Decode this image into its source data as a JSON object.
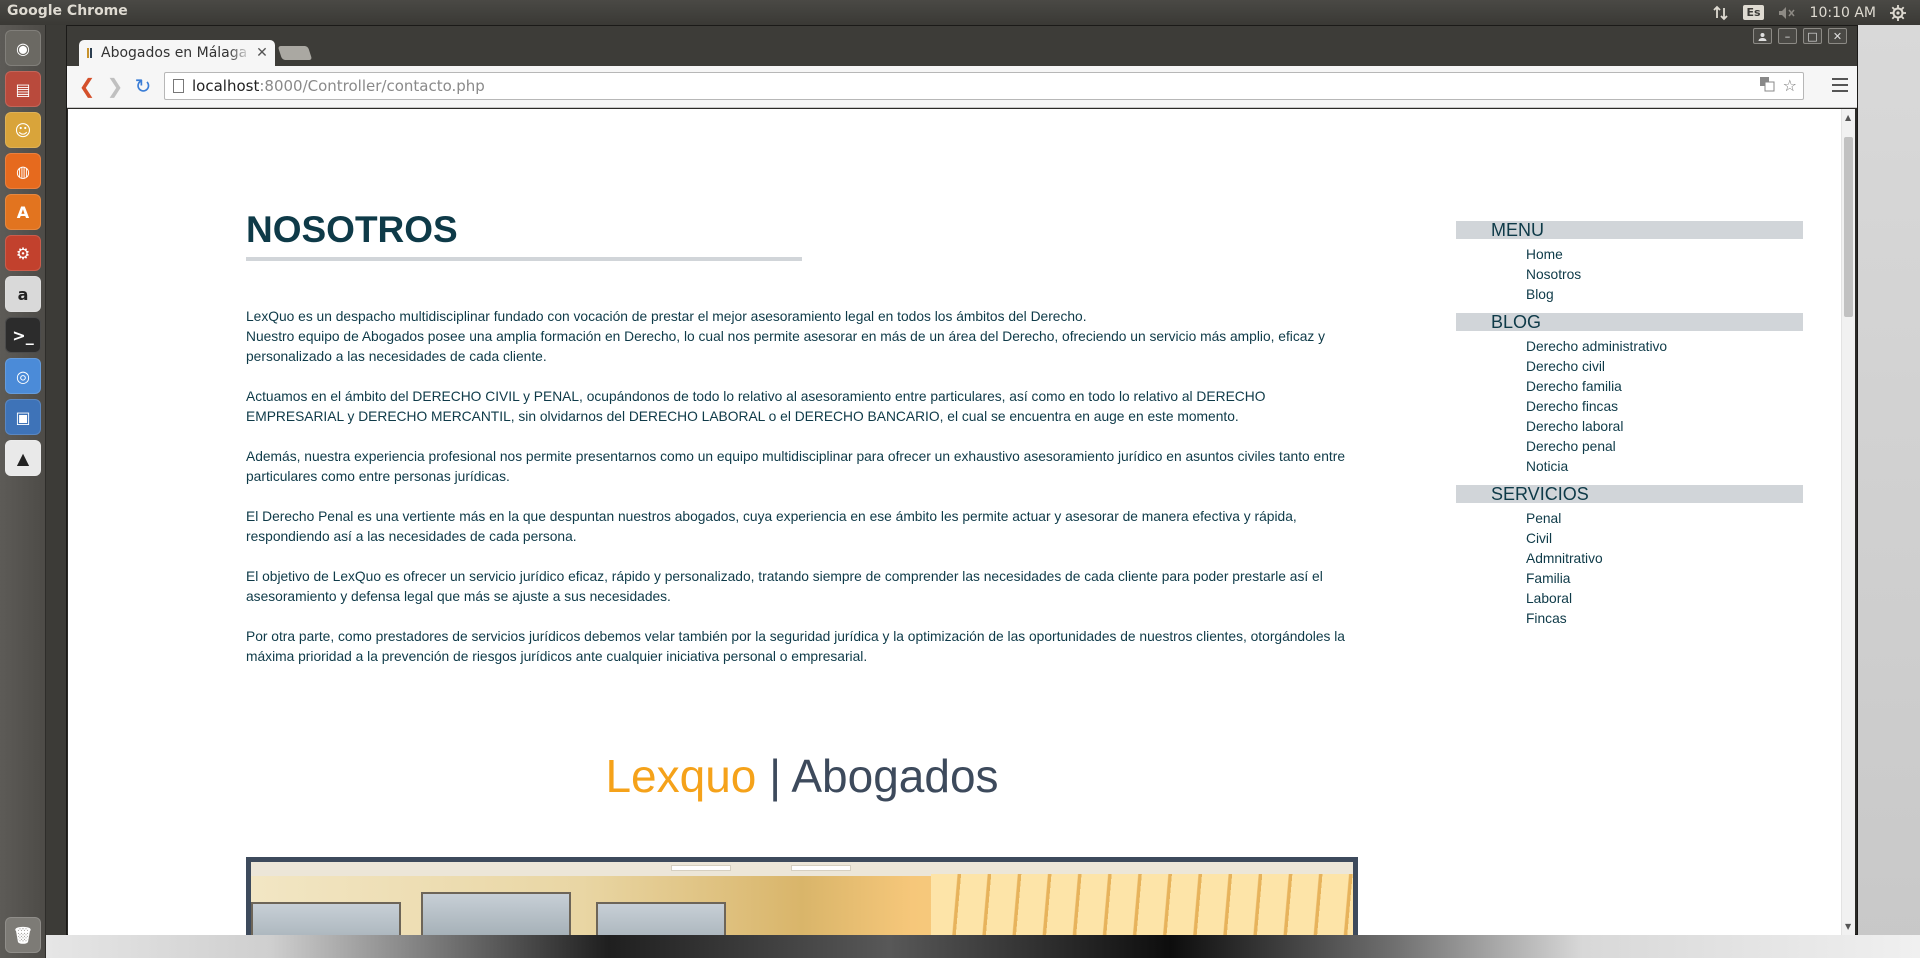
{
  "os": {
    "panel_app_name": "Google Chrome",
    "keyboard_layout": "Es",
    "clock": "10:10 AM"
  },
  "launcher": {
    "items": [
      {
        "name": "dash-home",
        "icon": "ubuntu-logo-icon",
        "color": "#6b6963"
      },
      {
        "name": "files",
        "icon": "file-cabinet-icon",
        "color": "#b94a3c"
      },
      {
        "name": "app-2",
        "icon": "face-icon",
        "color": "#d9a43a"
      },
      {
        "name": "firefox",
        "icon": "firefox-icon",
        "color": "#e66a1e"
      },
      {
        "name": "software-center",
        "icon": "shopping-bag-icon",
        "color": "#e2741f"
      },
      {
        "name": "system-settings",
        "icon": "gears-icon",
        "color": "#c2412d"
      },
      {
        "name": "amazon",
        "icon": "amazon-icon",
        "color": "#d9d9d9"
      },
      {
        "name": "terminal",
        "icon": "terminal-icon",
        "color": "#2c2c2c"
      },
      {
        "name": "chrome",
        "icon": "chrome-icon",
        "color": "#4b8bd8"
      },
      {
        "name": "virtualbox",
        "icon": "box-icon",
        "color": "#3e73b8"
      },
      {
        "name": "pma",
        "icon": "pma-icon",
        "color": "#e9e9e9"
      },
      {
        "name": "trash",
        "icon": "trash-icon",
        "color": "#7d7b76"
      }
    ]
  },
  "browser": {
    "tab_title": "Abogados en Málaga",
    "url_host": "localhost",
    "url_path": ":8000/Controller/contacto.php"
  },
  "page": {
    "title": "NOSOTROS",
    "paragraphs": [
      "LexQuo es un despacho multidisciplinar fundado con vocación de prestar el mejor asesoramiento legal en todos los ámbitos del Derecho.",
      "Nuestro equipo de Abogados posee una amplia formación en Derecho, lo cual nos permite asesorar en más de un área del Derecho, ofreciendo un servicio más amplio, eficaz y personalizado a las necesidades de cada cliente.",
      "Actuamos en el ámbito del DERECHO CIVIL y PENAL, ocupándonos de todo lo relativo al asesoramiento entre particulares, así como en todo lo relativo al DERECHO EMPRESARIAL y DERECHO MERCANTIL, sin olvidarnos del DERECHO LABORAL o el DERECHO BANCARIO, el cual se encuentra en auge en este momento.",
      "Además, nuestra experiencia profesional nos permite presentarnos como un equipo multidisciplinar para ofrecer un exhaustivo asesoramiento jurídico en asuntos civiles tanto entre particulares como entre personas jurídicas.",
      "El Derecho Penal es una vertiente más en la que despuntan nuestros abogados, cuya experiencia en ese ámbito les permite actuar y asesorar de manera efectiva y rápida, respondiendo así a las necesidades de cada persona.",
      "El objetivo de LexQuo es ofrecer un servicio jurídico eficaz, rápido y personalizado, tratando siempre de comprender las necesidades de cada cliente para poder prestarle así el asesoramiento y defensa legal que más se ajuste a sus necesidades.",
      "Por otra parte, como prestadores de servicios jurídicos debemos velar también por la seguridad jurídica y la optimización de las oportunidades de nuestros clientes, otorgándoles la máxima prioridad a la prevención de riesgos jurídicos ante cualquier iniciativa personal o empresarial."
    ],
    "brand_accent": "Lexquo",
    "brand_separator": "|",
    "brand_rest": "Abogados"
  },
  "sidebar": {
    "menu_heading": "MENU",
    "menu_items": [
      "Home",
      "Nosotros",
      "Blog"
    ],
    "blog_heading": "BLOG",
    "blog_items": [
      "Derecho administrativo",
      "Derecho civil",
      "Derecho familia",
      "Derecho fincas",
      "Derecho laboral",
      "Derecho penal",
      "Noticia"
    ],
    "services_heading": "SERVICIOS",
    "services_items": [
      "Penal",
      "Civil",
      "Admnitrativo",
      "Familia",
      "Laboral",
      "Fincas"
    ]
  },
  "colors": {
    "text_primary": "#0e3a48",
    "brand_orange": "#f5a21a",
    "brand_slate": "#3d4a5c",
    "sidebar_band": "#d1d5d9"
  }
}
